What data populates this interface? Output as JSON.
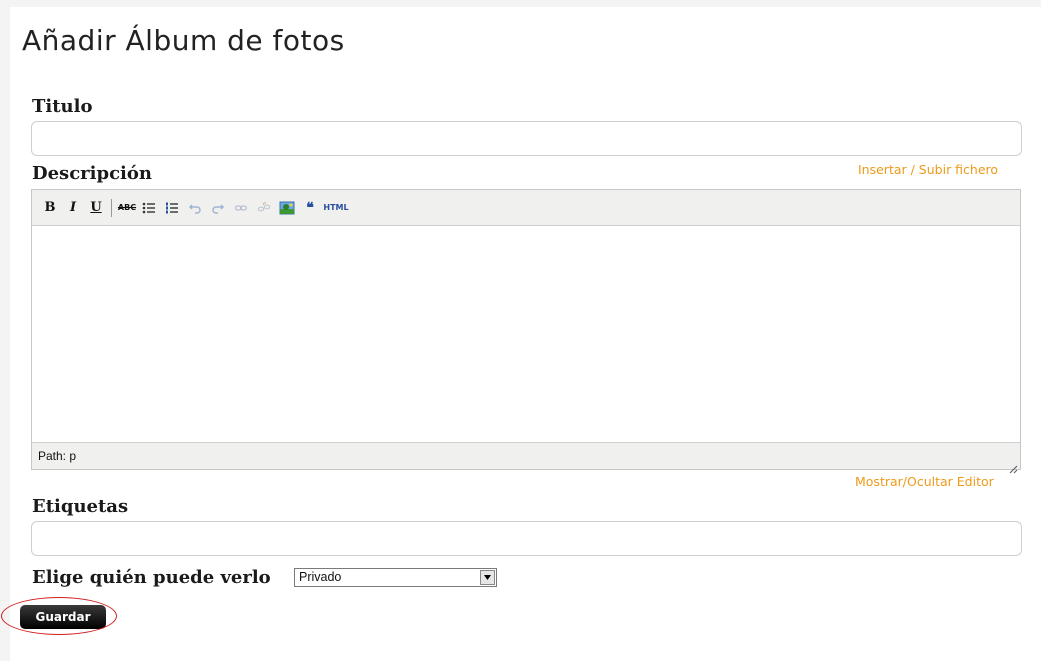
{
  "page": {
    "title": "Añadir Álbum de fotos"
  },
  "form": {
    "title_label": "Titulo",
    "title_value": "",
    "description_label": "Descripción",
    "insert_upload_link": "Insertar / Subir fichero",
    "editor": {
      "toolbar": {
        "bold": "B",
        "italic": "I",
        "underline": "U",
        "strikethrough": "ABC",
        "html": "HTML"
      },
      "path_text": "Path: p"
    },
    "toggle_editor_link": "Mostrar/Ocultar Editor",
    "tags_label": "Etiquetas",
    "tags_value": "",
    "visibility_label": "Elige quién puede verlo",
    "visibility_selected": "Privado",
    "save_label": "Guardar"
  },
  "colors": {
    "link": "#ee9a1a",
    "highlight": "#d21d1d",
    "button": "#000000"
  }
}
